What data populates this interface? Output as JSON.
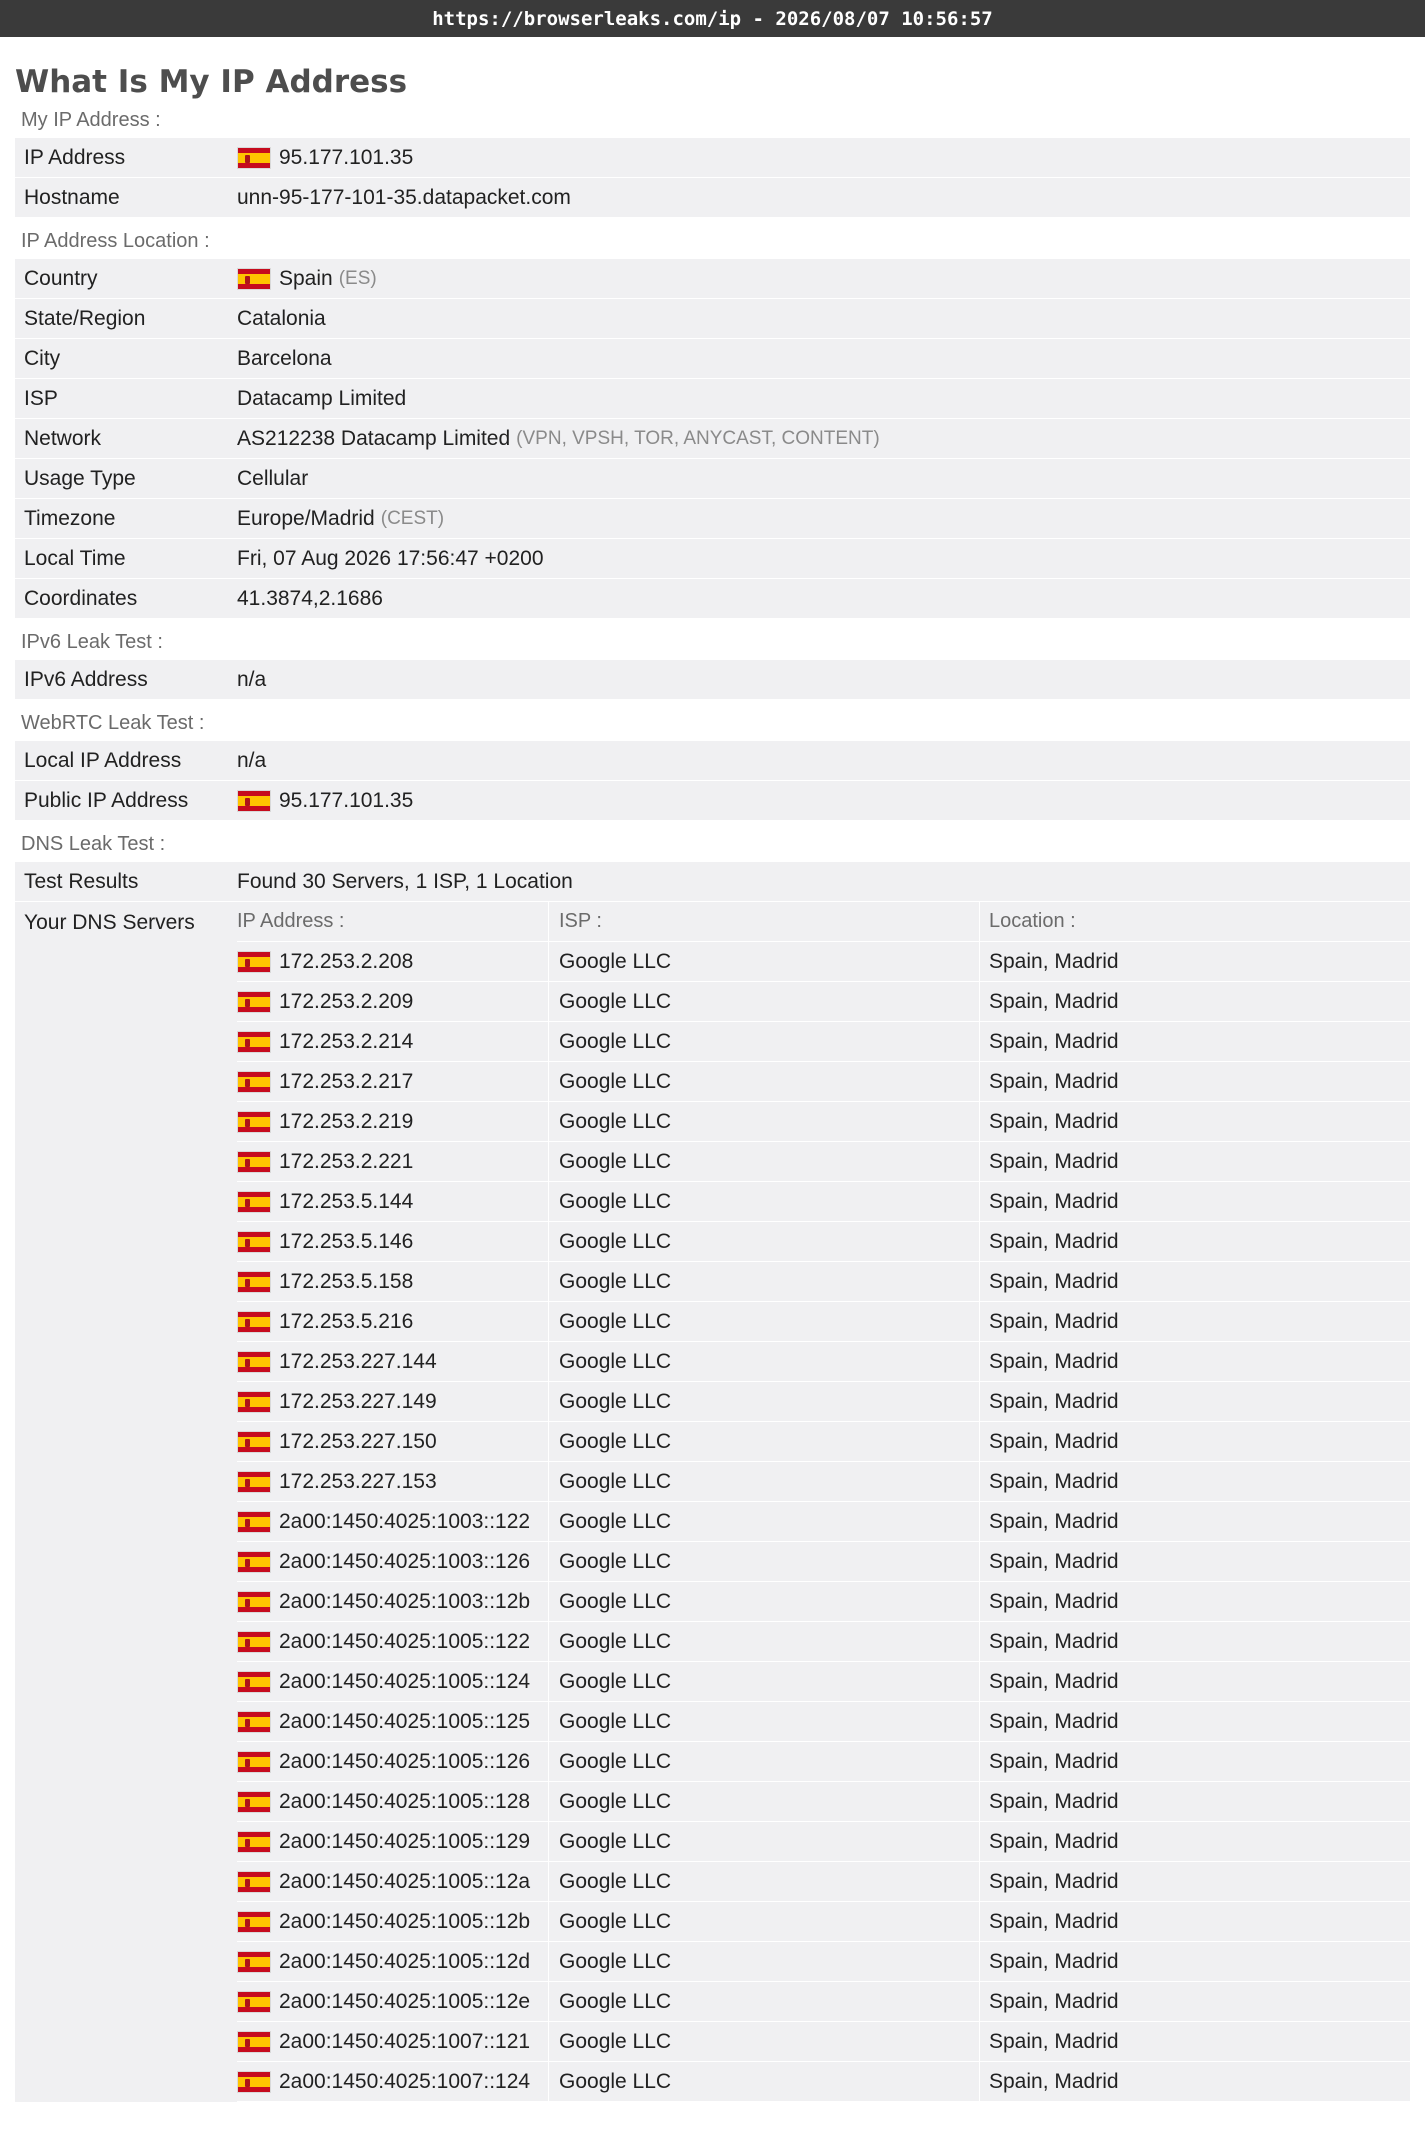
{
  "topbar": {
    "url_text": "https://browserleaks.com/ip - 2026/08/07 10:56:57"
  },
  "page": {
    "title": "What Is My IP Address"
  },
  "sections": {
    "my_ip": "My IP Address :",
    "location": "IP Address Location :",
    "ipv6": "IPv6 Leak Test :",
    "webrtc": "WebRTC Leak Test :",
    "dns": "DNS Leak Test :"
  },
  "my_ip": {
    "ip_label": "IP Address",
    "ip_value": "95.177.101.35",
    "host_label": "Hostname",
    "host_value": "unn-95-177-101-35.datapacket.com"
  },
  "location": {
    "country_label": "Country",
    "country_value": "Spain",
    "country_code": "(ES)",
    "region_label": "State/Region",
    "region_value": "Catalonia",
    "city_label": "City",
    "city_value": "Barcelona",
    "isp_label": "ISP",
    "isp_value": "Datacamp Limited",
    "network_label": "Network",
    "network_value": "AS212238 Datacamp Limited",
    "network_tags": "(VPN, VPSH, TOR, ANYCAST, CONTENT)",
    "usage_label": "Usage Type",
    "usage_value": "Cellular",
    "tz_label": "Timezone",
    "tz_value": "Europe/Madrid",
    "tz_abbr": "(CEST)",
    "time_label": "Local Time",
    "time_value": "Fri, 07 Aug 2026 17:56:47 +0200",
    "coords_label": "Coordinates",
    "coords_value": "41.3874,2.1686"
  },
  "ipv6": {
    "label": "IPv6 Address",
    "value": "n/a"
  },
  "webrtc": {
    "local_label": "Local IP Address",
    "local_value": "n/a",
    "public_label": "Public IP Address",
    "public_value": "95.177.101.35"
  },
  "dns": {
    "results_label": "Test Results",
    "results_value": "Found 30 Servers, 1 ISP, 1 Location",
    "servers_label": "Your DNS Servers",
    "col_ip": "IP Address :",
    "col_isp": "ISP :",
    "col_loc": "Location :",
    "servers": [
      {
        "ip": "172.253.2.208",
        "isp": "Google LLC",
        "loc": "Spain, Madrid"
      },
      {
        "ip": "172.253.2.209",
        "isp": "Google LLC",
        "loc": "Spain, Madrid"
      },
      {
        "ip": "172.253.2.214",
        "isp": "Google LLC",
        "loc": "Spain, Madrid"
      },
      {
        "ip": "172.253.2.217",
        "isp": "Google LLC",
        "loc": "Spain, Madrid"
      },
      {
        "ip": "172.253.2.219",
        "isp": "Google LLC",
        "loc": "Spain, Madrid"
      },
      {
        "ip": "172.253.2.221",
        "isp": "Google LLC",
        "loc": "Spain, Madrid"
      },
      {
        "ip": "172.253.5.144",
        "isp": "Google LLC",
        "loc": "Spain, Madrid"
      },
      {
        "ip": "172.253.5.146",
        "isp": "Google LLC",
        "loc": "Spain, Madrid"
      },
      {
        "ip": "172.253.5.158",
        "isp": "Google LLC",
        "loc": "Spain, Madrid"
      },
      {
        "ip": "172.253.5.216",
        "isp": "Google LLC",
        "loc": "Spain, Madrid"
      },
      {
        "ip": "172.253.227.144",
        "isp": "Google LLC",
        "loc": "Spain, Madrid"
      },
      {
        "ip": "172.253.227.149",
        "isp": "Google LLC",
        "loc": "Spain, Madrid"
      },
      {
        "ip": "172.253.227.150",
        "isp": "Google LLC",
        "loc": "Spain, Madrid"
      },
      {
        "ip": "172.253.227.153",
        "isp": "Google LLC",
        "loc": "Spain, Madrid"
      },
      {
        "ip": "2a00:1450:4025:1003::122",
        "isp": "Google LLC",
        "loc": "Spain, Madrid"
      },
      {
        "ip": "2a00:1450:4025:1003::126",
        "isp": "Google LLC",
        "loc": "Spain, Madrid"
      },
      {
        "ip": "2a00:1450:4025:1003::12b",
        "isp": "Google LLC",
        "loc": "Spain, Madrid"
      },
      {
        "ip": "2a00:1450:4025:1005::122",
        "isp": "Google LLC",
        "loc": "Spain, Madrid"
      },
      {
        "ip": "2a00:1450:4025:1005::124",
        "isp": "Google LLC",
        "loc": "Spain, Madrid"
      },
      {
        "ip": "2a00:1450:4025:1005::125",
        "isp": "Google LLC",
        "loc": "Spain, Madrid"
      },
      {
        "ip": "2a00:1450:4025:1005::126",
        "isp": "Google LLC",
        "loc": "Spain, Madrid"
      },
      {
        "ip": "2a00:1450:4025:1005::128",
        "isp": "Google LLC",
        "loc": "Spain, Madrid"
      },
      {
        "ip": "2a00:1450:4025:1005::129",
        "isp": "Google LLC",
        "loc": "Spain, Madrid"
      },
      {
        "ip": "2a00:1450:4025:1005::12a",
        "isp": "Google LLC",
        "loc": "Spain, Madrid"
      },
      {
        "ip": "2a00:1450:4025:1005::12b",
        "isp": "Google LLC",
        "loc": "Spain, Madrid"
      },
      {
        "ip": "2a00:1450:4025:1005::12d",
        "isp": "Google LLC",
        "loc": "Spain, Madrid"
      },
      {
        "ip": "2a00:1450:4025:1005::12e",
        "isp": "Google LLC",
        "loc": "Spain, Madrid"
      },
      {
        "ip": "2a00:1450:4025:1007::121",
        "isp": "Google LLC",
        "loc": "Spain, Madrid"
      },
      {
        "ip": "2a00:1450:4025:1007::124",
        "isp": "Google LLC",
        "loc": "Spain, Madrid"
      }
    ]
  },
  "icons": {
    "flag": "spain-flag-icon"
  }
}
